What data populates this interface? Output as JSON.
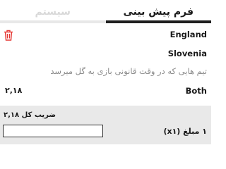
{
  "tabs": [
    {
      "label": "فرم پیش بینی"
    },
    {
      "label": "سیستم"
    }
  ],
  "bet": {
    "team_home": "England",
    "team_away": "Slovenia",
    "market": "تیم هایی که در وقت قانونی بازی به گل میرسد",
    "selection": "Both",
    "odds": "۲,۱۸"
  },
  "footer": {
    "total_odds_label": "ضریب کل",
    "total_odds_value": "۲,۱۸",
    "stake_label": "۱ مبلغ (x۱)",
    "stake_value": ""
  },
  "colors": {
    "delete_icon": "#e53935",
    "footer_bg": "#e9e9e9",
    "active_tab_underline": "#1f1f1f"
  }
}
